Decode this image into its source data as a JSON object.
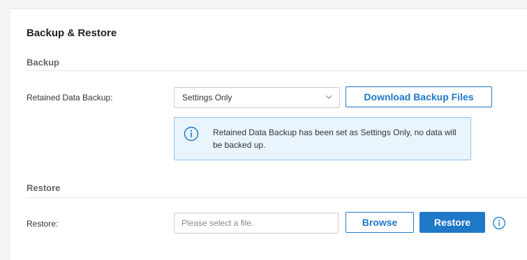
{
  "card": {
    "title": "Backup & Restore"
  },
  "backup": {
    "section_title": "Backup",
    "retained_label": "Retained Data Backup:",
    "retained_selected": "Settings Only",
    "download_button": "Download Backup Files",
    "notice": "Retained Data Backup has been set as Settings Only, no data will be backed up.",
    "notice_icon": "info-circle-icon"
  },
  "restore": {
    "section_title": "Restore",
    "restore_label": "Restore:",
    "file_placeholder": "Please select a file.",
    "browse_button": "Browse",
    "restore_button": "Restore",
    "help_icon": "info-circle-icon"
  },
  "colors": {
    "accent": "#1f78c8",
    "notice_bg": "#eaf4fc",
    "notice_border": "#8fc3ee",
    "page_bg": "#f3f4f6"
  }
}
